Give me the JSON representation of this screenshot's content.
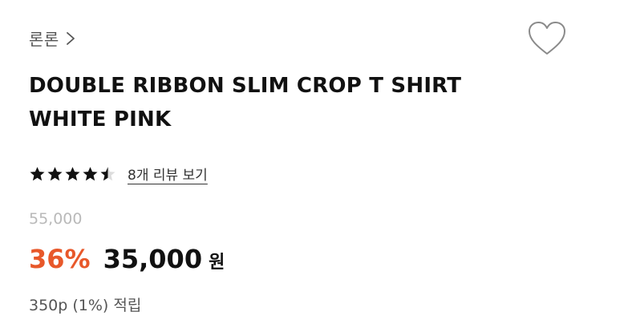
{
  "brand": {
    "name": "론론",
    "chevron_icon": "chevron-right-icon"
  },
  "wishlist": {
    "icon": "heart-outline-icon"
  },
  "product": {
    "title_line1": "DOUBLE RIBBON SLIM CROP T SHIRT",
    "title_line2": "WHITE PINK"
  },
  "rating": {
    "score": 4.5,
    "max": 5,
    "review_link": "8개 리뷰 보기"
  },
  "price": {
    "original": "55,000",
    "discount": "36%",
    "sale": "35,000",
    "currency": "원"
  },
  "points": {
    "text": "350p (1%) 적립"
  },
  "colors": {
    "accent": "#e8582a",
    "text": "#111111",
    "muted": "#b9b9b9"
  }
}
